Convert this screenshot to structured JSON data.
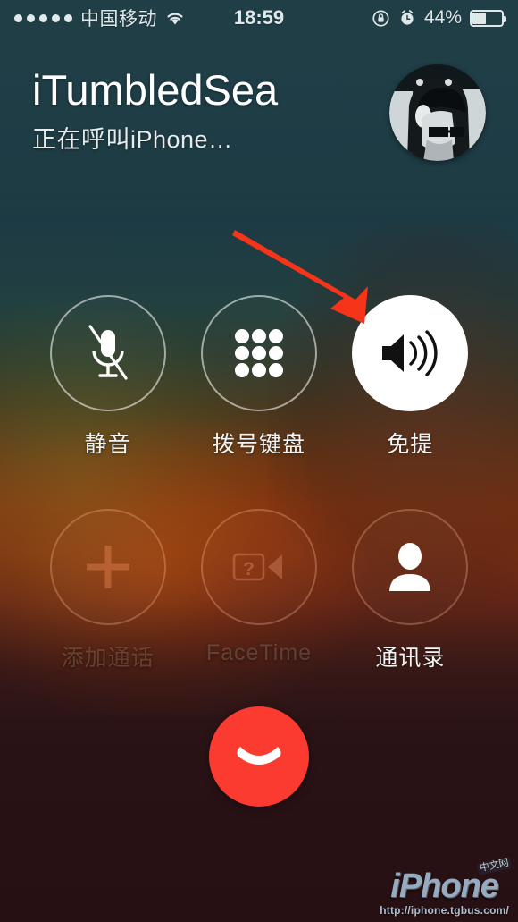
{
  "statusbar": {
    "signal_dots": 5,
    "carrier": "中国移动",
    "wifi_icon": "wifi-icon",
    "time": "18:59",
    "rotation_lock_icon": "rotation-lock-icon",
    "alarm_icon": "alarm-clock-icon",
    "battery_percent": "44%",
    "battery_level": 44
  },
  "call": {
    "contact_name": "iTumbledSea",
    "status_text": "正在呼叫iPhone…",
    "avatar_name": "contact-avatar"
  },
  "buttons": [
    {
      "id": "mute",
      "label": "静音",
      "icon": "microphone-muted-icon",
      "state": "normal"
    },
    {
      "id": "keypad",
      "label": "拨号键盘",
      "icon": "keypad-icon",
      "state": "normal"
    },
    {
      "id": "speaker",
      "label": "免提",
      "icon": "speaker-icon",
      "state": "active"
    },
    {
      "id": "add_call",
      "label": "添加通话",
      "icon": "plus-icon",
      "state": "disabled"
    },
    {
      "id": "facetime",
      "label": "FaceTime",
      "icon": "facetime-video-icon",
      "state": "disabled"
    },
    {
      "id": "contacts",
      "label": "通讯录",
      "icon": "person-icon",
      "state": "normal"
    }
  ],
  "end_call": {
    "icon": "end-call-handset-icon",
    "color": "#fb3b30"
  },
  "annotation": {
    "arrow_color": "#f5341a",
    "points_to": "speaker-button"
  },
  "watermark": {
    "text": "iPhone",
    "badge": "中文网",
    "url": "http://iphone.tgbus.com/"
  }
}
